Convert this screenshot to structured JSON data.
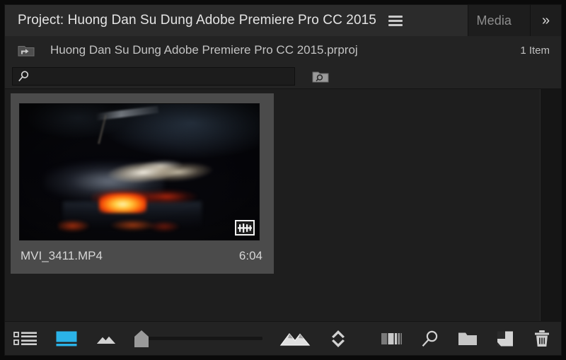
{
  "window": {
    "app": "Adobe Premiere Pro CC 2015",
    "frame_color": "#0a0a0a",
    "panel_bg": "#232323",
    "content_bg": "#1e1e1e",
    "accent_color": "#2bb3e8"
  },
  "tabs": [
    {
      "label": "Project: Huong Dan Su Dung Adobe Premiere Pro CC 2015",
      "active": true,
      "name": "tab-project"
    },
    {
      "label": "Media",
      "active": false,
      "truncated": true,
      "name": "tab-media"
    }
  ],
  "tab_bar": {
    "panel_menu_icon": "hamburger-menu-icon",
    "overflow_icon": "chevron-double-right-icon",
    "overflow_label": "»"
  },
  "breadcrumb": {
    "parent_icon": "parent-folder-up-icon",
    "project_name": "Huong Dan Su Dung Adobe Premiere Pro CC 2015.prproj",
    "item_count": "1 Item"
  },
  "search": {
    "icon": "search-icon",
    "value": "",
    "placeholder": "",
    "find_in_bin_icon": "folder-search-icon"
  },
  "items": [
    {
      "name": "MVI_3411.MP4",
      "duration": "6:04",
      "selected": true,
      "badge_icon": "clip-waveform-badge-icon",
      "thumbnail_description": "Night campfire with glowing orange embers and pale ash"
    }
  ],
  "toolbar": {
    "left": [
      {
        "name": "list-view-button",
        "icon": "list-view-icon",
        "active": false,
        "label": "List View"
      },
      {
        "name": "icon-view-button",
        "icon": "icon-view-icon",
        "active": true,
        "label": "Icon View"
      },
      {
        "name": "zoom-out-button",
        "icon": "mountain-small-icon",
        "label": "Zoom Out"
      }
    ],
    "zoom_slider": {
      "name": "thumbnail-zoom-slider",
      "value": 0,
      "min": 0,
      "max": 100,
      "thumb_icon": "slider-thumb-icon",
      "track_color": "#161616"
    },
    "zoom_in": {
      "name": "zoom-in-button",
      "icon": "mountain-large-icon",
      "label": "Zoom In"
    },
    "sort": {
      "name": "sort-icon-button",
      "icon": "sort-diamond-icon",
      "label": "Sort Icons"
    },
    "right": [
      {
        "name": "freeform-view-button",
        "icon": "columns-bars-icon",
        "label": "Freeform View"
      },
      {
        "name": "find-button",
        "icon": "search-icon",
        "label": "Find"
      },
      {
        "name": "new-bin-button",
        "icon": "folder-icon",
        "label": "New Bin"
      },
      {
        "name": "new-item-button",
        "icon": "new-item-page-icon",
        "label": "New Item"
      },
      {
        "name": "clear-button",
        "icon": "trash-icon",
        "label": "Clear"
      }
    ]
  },
  "scrollbar": {
    "name": "vertical-scrollbar",
    "track_color": "#151515"
  }
}
